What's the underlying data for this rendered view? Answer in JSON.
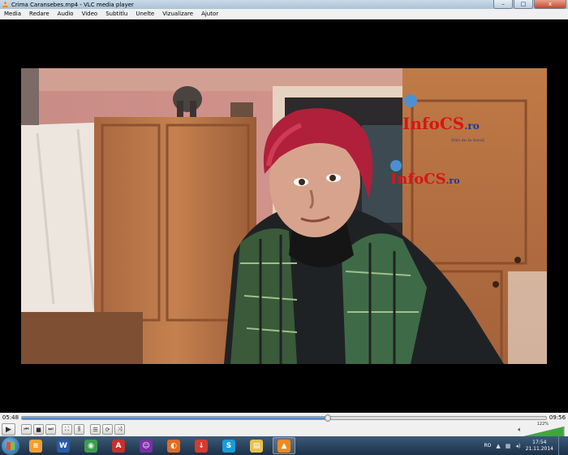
{
  "window": {
    "title": "Crima Caransebes.mp4 - VLC media player",
    "minimize": "–",
    "maximize": "□",
    "close": "x"
  },
  "menu": [
    "Media",
    "Redare",
    "Audio",
    "Video",
    "Subtitlu",
    "Unelte",
    "Vizualizare",
    "Ajutor"
  ],
  "playback": {
    "elapsed": "05:48",
    "total": "09:56",
    "progress": 0.584
  },
  "volume": {
    "label": "122%",
    "level": 1.22
  },
  "watermark": {
    "brand_a": "InfoCS",
    "brand_a_tld": ".ro",
    "tagline": "Știri de la Sursă",
    "brand_b": "InfoCS",
    "brand_b_tld": ".ro"
  },
  "taskbar": {
    "apps": [
      {
        "name": "explorer-app-icon",
        "glyph": "≋",
        "color": "#f0a030"
      },
      {
        "name": "word-app-icon",
        "glyph": "W",
        "color": "#2a5aa8"
      },
      {
        "name": "chrome-app-icon",
        "glyph": "◉",
        "color": "#3c9d4c"
      },
      {
        "name": "pdf-app-icon",
        "glyph": "A",
        "color": "#c9302c"
      },
      {
        "name": "yahoo-messenger-app-icon",
        "glyph": "☺",
        "color": "#7b2fa3"
      },
      {
        "name": "firefox-app-icon",
        "glyph": "◐",
        "color": "#e36b1e"
      },
      {
        "name": "download-app-icon",
        "glyph": "↓",
        "color": "#d63a2f"
      },
      {
        "name": "skype-app-icon",
        "glyph": "S",
        "color": "#1a9bd8"
      },
      {
        "name": "folder-app-icon",
        "glyph": "▤",
        "color": "#e8c14b"
      },
      {
        "name": "vlc-app-icon",
        "glyph": "▲",
        "color": "#f08a1c"
      }
    ],
    "language": "RO",
    "time": "17:54",
    "date": "21.11.2014"
  }
}
